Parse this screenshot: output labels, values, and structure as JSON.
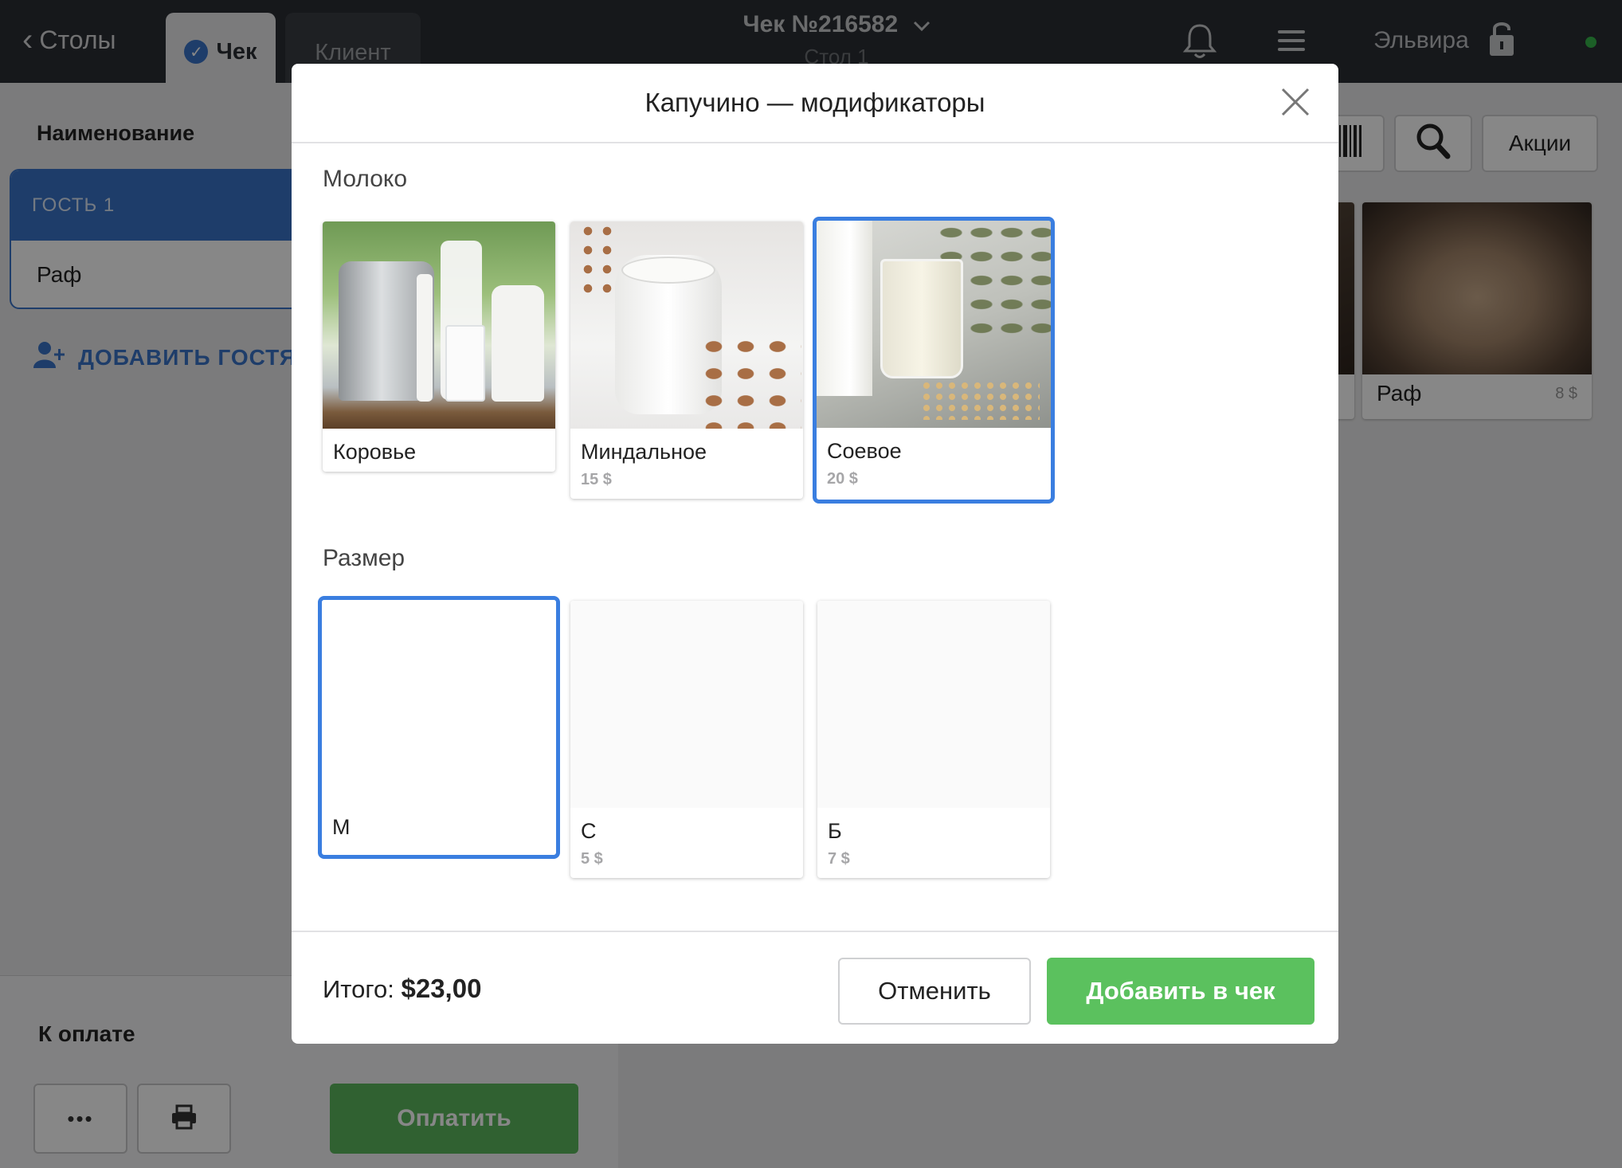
{
  "topbar": {
    "back_label": "Столы",
    "tab_check": "Чек",
    "tab_client": "Клиент",
    "order_title": "Чек №216582",
    "order_subtitle": "Стол 1",
    "user_name": "Эльвира"
  },
  "left": {
    "header": "Наименование",
    "guest_label": "ГОСТЬ 1",
    "item_label": "Раф",
    "add_guest_label": "ДОБАВИТЬ ГОСТЯ",
    "to_pay_label": "К оплате",
    "more_label": "•••",
    "pay_label": "Оплатить"
  },
  "right": {
    "promo_label": "Акции",
    "product": {
      "name": "Раф",
      "price": "8 $"
    }
  },
  "modal": {
    "title": "Капучино — модификаторы",
    "milk_label": "Молоко",
    "milk_options": [
      {
        "name": "Коровье",
        "price": ""
      },
      {
        "name": "Миндальное",
        "price": "15 $"
      },
      {
        "name": "Соевое",
        "price": "20 $",
        "selected": true
      }
    ],
    "size_label": "Размер",
    "size_options": [
      {
        "name": "М",
        "price": "",
        "selected": true
      },
      {
        "name": "С",
        "price": "5 $"
      },
      {
        "name": "Б",
        "price": "7 $"
      }
    ],
    "total_label": "Итого:",
    "total_value": "$23,00",
    "cancel_label": "Отменить",
    "add_label": "Добавить в чек"
  },
  "colors": {
    "accent_blue": "#3a7ee0",
    "confirm_green": "#5bc15e",
    "topbar_bg": "#2b2e33",
    "online_dot": "#36b34a"
  },
  "icons": [
    "chevron-left-icon",
    "check-circle-icon",
    "chevron-down-icon",
    "bell-icon",
    "menu-icon",
    "lock-icon",
    "add-user-icon",
    "barcode-icon",
    "search-icon",
    "close-icon",
    "print-icon"
  ]
}
